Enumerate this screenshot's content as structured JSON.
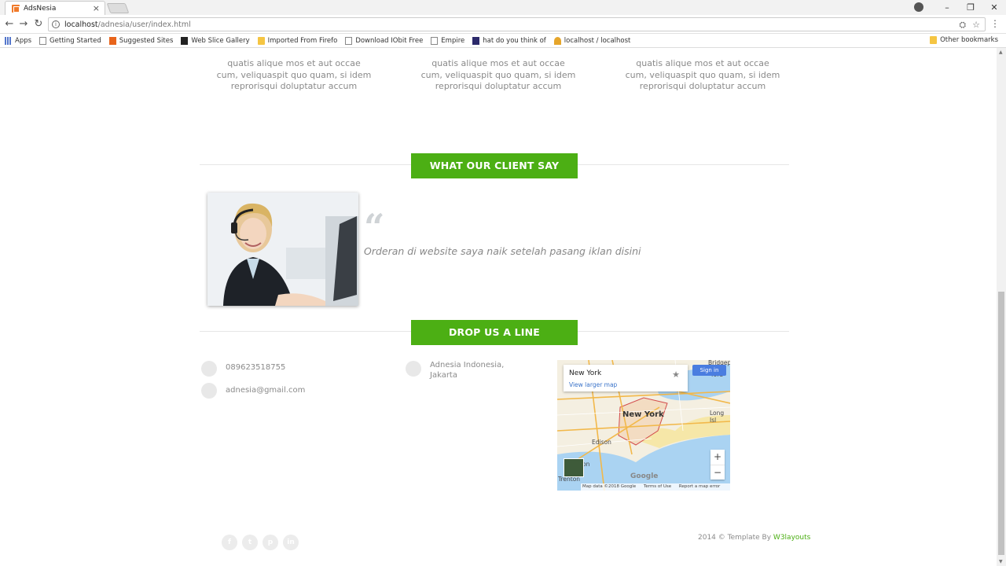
{
  "browser": {
    "tab_title": "AdsNesia",
    "tab_close": "×",
    "url_host": "localhost",
    "url_path": "/adnesia/user/index.html",
    "window_controls": [
      "–",
      "❐",
      "✕"
    ]
  },
  "bookmarks": {
    "items": [
      {
        "label": "Apps",
        "icon": "apps-icon"
      },
      {
        "label": "Getting Started",
        "icon": "page-icon"
      },
      {
        "label": "Suggested Sites",
        "icon": "suggested-icon"
      },
      {
        "label": "Web Slice Gallery",
        "icon": "webslice-icon"
      },
      {
        "label": "Imported From Firefo",
        "icon": "folder-icon"
      },
      {
        "label": "Download IObit Free",
        "icon": "page-icon"
      },
      {
        "label": "Empire",
        "icon": "page-icon"
      },
      {
        "label": "hat do you think of",
        "icon": "empire-icon"
      },
      {
        "label": "localhost / localhost",
        "icon": "phpmyadmin-icon"
      }
    ],
    "other": "Other bookmarks"
  },
  "features": {
    "items": [
      "quatis alique mos et aut occae cum, veliquaspit quo quam, si idem reprorisqui doluptatur accum",
      "quatis alique mos et aut occae cum, veliquaspit quo quam, si idem reprorisqui doluptatur accum",
      "quatis alique mos et aut occae cum, veliquaspit quo quam, si idem reprorisqui doluptatur accum"
    ]
  },
  "testimonials": {
    "title": "WHAT OUR CLIENT SAY",
    "quote_mark": "“",
    "text": "Orderan di website saya naik setelah pasang iklan disini"
  },
  "contact": {
    "title": "DROP US A LINE",
    "phone": "089623518755",
    "email": "adnesia@gmail.com",
    "address_line1": "Adnesia Indonesia,",
    "address_line2": "Jakarta"
  },
  "map": {
    "card_title": "New York",
    "card_link": "View larger map",
    "signin": "Sign in",
    "city_label": "New York",
    "labels": {
      "edison": "Edison",
      "long_island": "Long Isl",
      "on": "on",
      "trenton": "Trenton",
      "bridgeport": "Bridgepo",
      "ford": "ford"
    },
    "google": "Google",
    "footer": [
      "Map data ©2018 Google",
      "Terms of Use",
      "Report a map error"
    ],
    "zoom_in": "+",
    "zoom_out": "−"
  },
  "footer": {
    "social": [
      "f",
      "t",
      "p",
      "in"
    ],
    "copyright": "2014 © Template By ",
    "credit": "W3layouts"
  },
  "colors": {
    "accent_green": "#4caf14",
    "muted_text": "#8a8a8a"
  }
}
